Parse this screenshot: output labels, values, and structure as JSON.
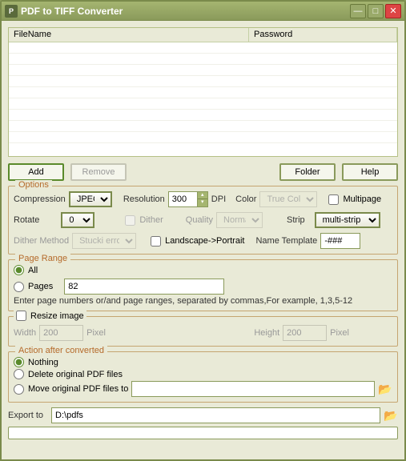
{
  "window": {
    "title": "PDF to TIFF Converter",
    "icon": "P"
  },
  "filelist": {
    "col_filename": "FileName",
    "col_password": "Password"
  },
  "buttons": {
    "add": "Add",
    "remove": "Remove",
    "folder": "Folder",
    "help": "Help"
  },
  "options": {
    "legend": "Options",
    "compression_lbl": "Compression",
    "compression_val": "JPEG",
    "resolution_lbl": "Resolution",
    "resolution_val": "300",
    "dpi_lbl": "DPI",
    "color_lbl": "Color",
    "color_val": "True Color",
    "multipage_lbl": "Multipage",
    "rotate_lbl": "Rotate",
    "rotate_val": "0",
    "dither_lbl": "Dither",
    "quality_lbl": "Quality",
    "quality_val": "Normal",
    "strip_lbl": "Strip",
    "strip_val": "multi-strip",
    "dithermethod_lbl": "Dither Method",
    "dithermethod_val": "Stucki error",
    "landscape_lbl": "Landscape->Portrait",
    "nametpl_lbl": "Name Template",
    "nametpl_val": "-###"
  },
  "pagerange": {
    "legend": "Page Range",
    "all_lbl": "All",
    "pages_lbl": "Pages",
    "pages_val": "82",
    "hint": "Enter page numbers or/and page ranges, separated by commas,For example, 1,3,5-12"
  },
  "resize": {
    "check_lbl": "Resize image",
    "width_lbl": "Width",
    "width_val": "200",
    "width_unit": "Pixel",
    "height_lbl": "Height",
    "height_val": "200",
    "height_unit": "Pixel"
  },
  "action": {
    "legend": "Action after converted",
    "nothing_lbl": "Nothing",
    "delete_lbl": "Delete original PDF files",
    "move_lbl": "Move original PDF files to",
    "move_path": ""
  },
  "export": {
    "lbl": "Export to",
    "val": "D:\\pdfs"
  }
}
